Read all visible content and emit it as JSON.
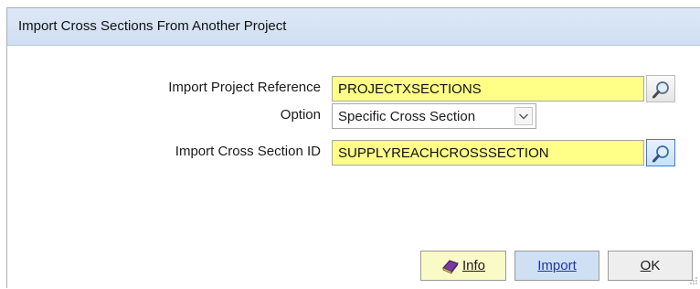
{
  "window": {
    "title": "Import Cross Sections From Another Project"
  },
  "form": {
    "project_reference": {
      "label": "Import Project Reference",
      "value": "PROJECTXSECTIONS"
    },
    "option": {
      "label": "Option",
      "value": "Specific Cross Section"
    },
    "cross_section_id": {
      "label": "Import Cross Section ID",
      "value": "SUPPLYREACHCROSSSECTION"
    }
  },
  "buttons": {
    "info": "Info",
    "import": "Import",
    "ok_underlined": "O",
    "ok_rest": "K"
  },
  "colors": {
    "field_required": "#ffff88",
    "titlebar": "#dde8f6",
    "info_button": "#fafac6",
    "import_button": "#cfe0f5"
  },
  "icons": {
    "lookup": "magnifier-icon",
    "dropdown": "chevron-down-icon",
    "info": "book-icon",
    "resize": "resize-grip-icon"
  }
}
